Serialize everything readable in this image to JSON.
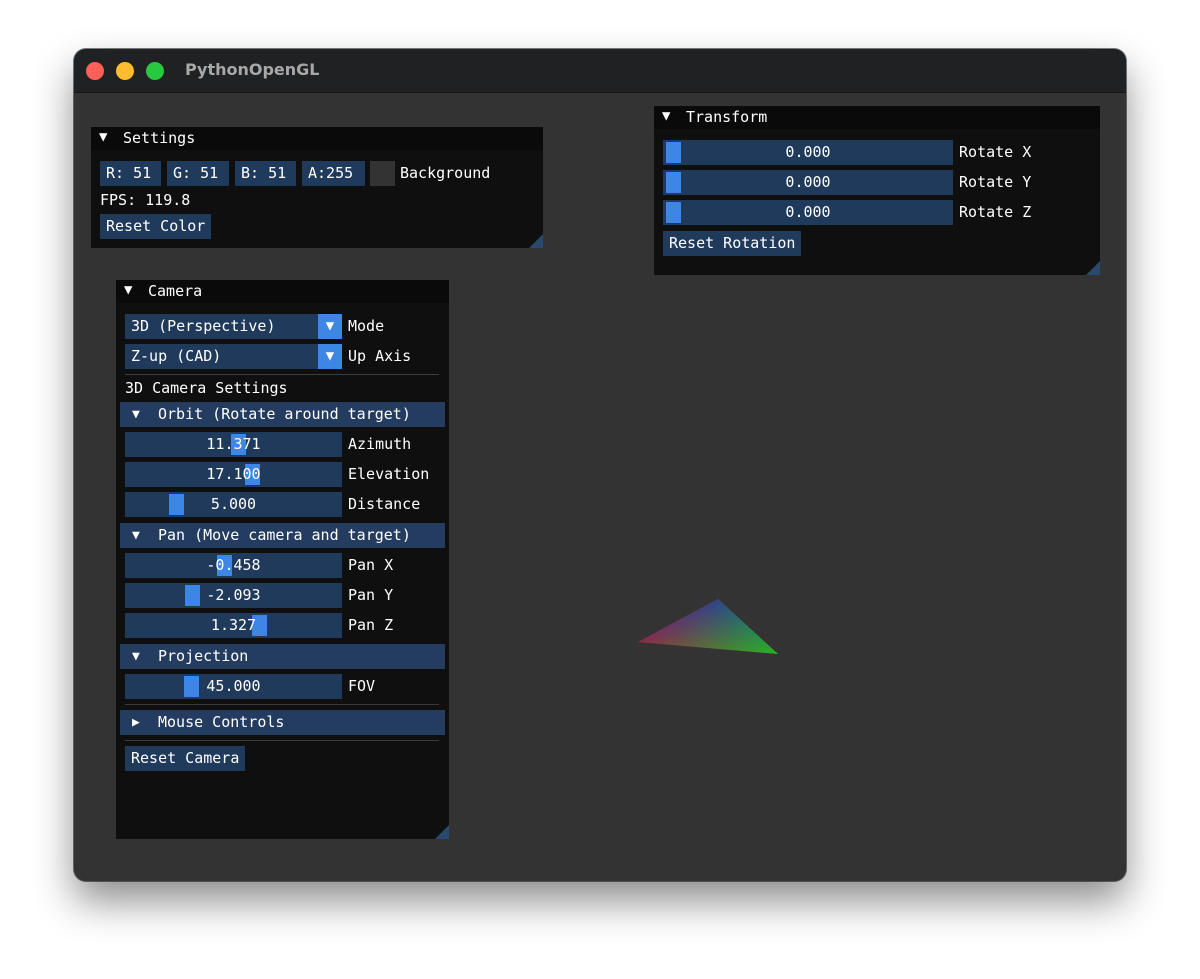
{
  "window": {
    "title": "PythonOpenGL"
  },
  "settings": {
    "title": "Settings",
    "collapse_icon": "triangle-down",
    "r_label": "R: 51",
    "g_label": "G: 51",
    "b_label": "B: 51",
    "a_label": "A:255",
    "swatch_color": "#333333",
    "background_label": "Background",
    "fps": "FPS: 119.8",
    "reset_label": "Reset Color"
  },
  "transform": {
    "title": "Transform",
    "rotate_x": {
      "value": "0.000",
      "label": "Rotate X"
    },
    "rotate_y": {
      "value": "0.000",
      "label": "Rotate Y"
    },
    "rotate_z": {
      "value": "0.000",
      "label": "Rotate Z"
    },
    "reset_label": "Reset Rotation"
  },
  "camera": {
    "title": "Camera",
    "mode": {
      "value": "3D (Perspective)",
      "label": "Mode"
    },
    "up_axis": {
      "value": "Z-up (CAD)",
      "label": "Up Axis"
    },
    "settings_heading": "3D Camera Settings",
    "orbit": {
      "header": "Orbit (Rotate around target)",
      "azimuth": {
        "value": "11.371",
        "label": "Azimuth"
      },
      "elevation": {
        "value": "17.100",
        "label": "Elevation"
      },
      "distance": {
        "value": "5.000",
        "label": "Distance"
      }
    },
    "pan": {
      "header": "Pan (Move camera and target)",
      "pan_x": {
        "value": "-0.458",
        "label": "Pan X"
      },
      "pan_y": {
        "value": "-2.093",
        "label": "Pan Y"
      },
      "pan_z": {
        "value": "1.327",
        "label": "Pan Z"
      }
    },
    "projection": {
      "header": "Projection",
      "fov": {
        "value": "45.000",
        "label": "FOV"
      }
    },
    "mouse_controls": {
      "header": "Mouse Controls"
    },
    "reset_label": "Reset Camera"
  },
  "colors": {
    "accent": "#3d86e6",
    "frame": "#203a5c",
    "background": "#333333",
    "triangle": [
      "#ff0000",
      "#00ff00",
      "#0000ff"
    ]
  }
}
